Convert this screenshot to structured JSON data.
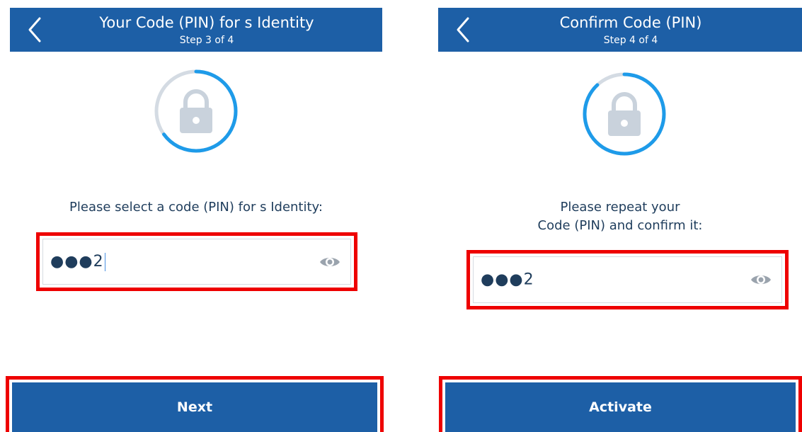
{
  "screens": [
    {
      "title": "Your Code (PIN) for s Identity",
      "step": "Step 3 of 4",
      "prompt": "Please select a code (PIN) for s Identity:",
      "pin_value": "●●●2",
      "button_label": "Next",
      "progress_fraction": 0.65
    },
    {
      "title": "Confirm Code (PIN)",
      "step": "Step 4 of 4",
      "prompt": "Please repeat your\nCode (PIN) and confirm it:",
      "pin_value": "●●●2",
      "button_label": "Activate",
      "progress_fraction": 0.88
    }
  ],
  "colors": {
    "brand_blue": "#1d5fa6",
    "progress_blue": "#1e9be9",
    "ring_track": "#d4dbe3",
    "lock_gray": "#c9d2dc",
    "highlight_red": "#ee0000"
  },
  "icons": {
    "back": "chevron-left-icon",
    "lock": "lock-icon",
    "visibility": "eye-icon"
  }
}
